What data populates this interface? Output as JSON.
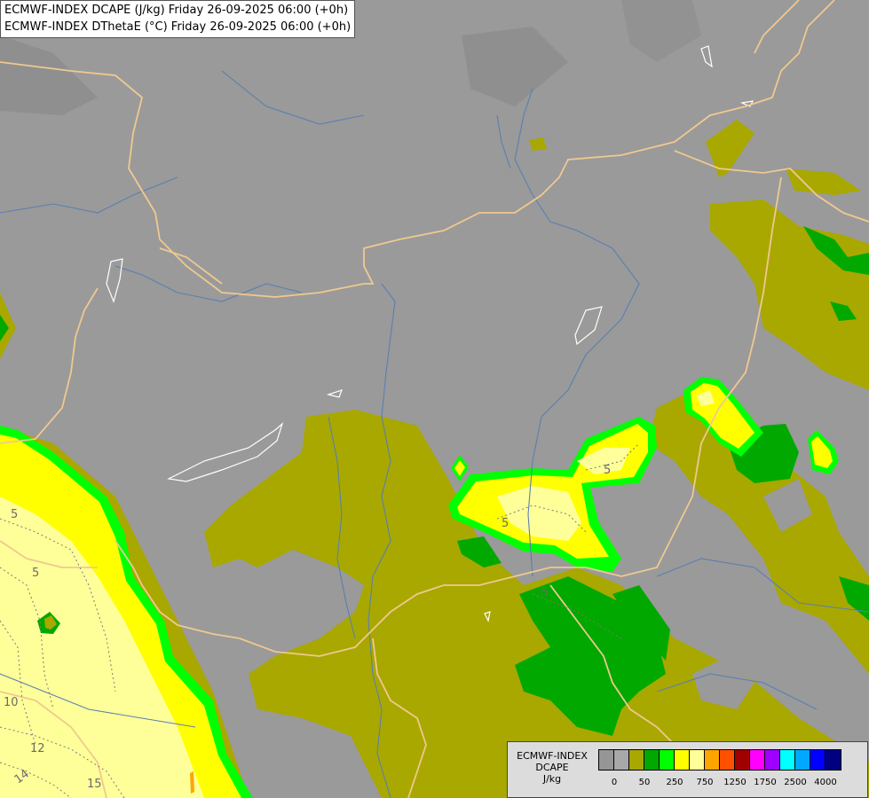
{
  "title": {
    "line1": "ECMWF-INDEX DCAPE (J/kg) Friday 26-09-2025 06:00 (+0h)",
    "line2": "ECMWF-INDEX DThetaE (°C) Friday 26-09-2025 06:00 (+0h)"
  },
  "legend": {
    "model": "ECMWF-INDEX",
    "variable": "DCAPE",
    "unit": "J/kg",
    "swatches": [
      "#969696",
      "#a8a8a8",
      "#a8a800",
      "#00a800",
      "#00ff00",
      "#ffff00",
      "#ffff9a",
      "#ffa500",
      "#ff5000",
      "#a00000",
      "#ff00ff",
      "#a000ff",
      "#00ffff",
      "#00a8ff",
      "#0000ff",
      "#000080"
    ],
    "ticks": [
      "0",
      "50",
      "250",
      "750",
      "1250",
      "1750",
      "2500",
      "4000"
    ]
  },
  "isolines": [
    "5",
    "5",
    "5",
    "5",
    "5",
    "10",
    "12",
    "14",
    "15"
  ],
  "colors": {
    "background": "#9a9a9a",
    "olive": "#a8a800",
    "green": "#00a800",
    "bright_green": "#00ff00",
    "yellow": "#ffff00",
    "pale_yellow": "#ffff9a",
    "orange": "#ffa500",
    "borders": "#f0c890",
    "rivers": "#5a7fb0",
    "lakes": "#ffffff"
  }
}
